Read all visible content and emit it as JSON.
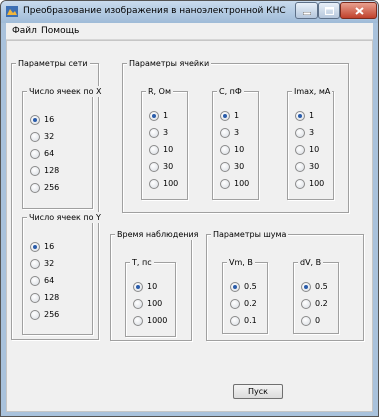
{
  "window": {
    "title": "Преобразование изображения в наноэлектронной КНС",
    "controls": {
      "minimize_icon": "minimize-icon",
      "maximize_icon": "maximize-icon",
      "close_icon": "close-icon"
    }
  },
  "menu": [
    {
      "label": "Файл"
    },
    {
      "label": "Помощь"
    }
  ],
  "network": {
    "title": "Параметры сети",
    "cells_x": {
      "title": "Число ячеек по X",
      "options": [
        "16",
        "32",
        "64",
        "128",
        "256"
      ],
      "selected": "16"
    },
    "cells_y": {
      "title": "Число ячеек по Y",
      "options": [
        "16",
        "32",
        "64",
        "128",
        "256"
      ],
      "selected": "16"
    }
  },
  "cell": {
    "title": "Параметры ячейки",
    "r": {
      "title": "R, Ом",
      "options": [
        "1",
        "3",
        "10",
        "30",
        "100"
      ],
      "selected": "1"
    },
    "c": {
      "title": "C, пФ",
      "options": [
        "1",
        "3",
        "10",
        "30",
        "100"
      ],
      "selected": "1"
    },
    "imax": {
      "title": "Imax, мА",
      "options": [
        "1",
        "3",
        "10",
        "30",
        "100"
      ],
      "selected": "1"
    }
  },
  "observation": {
    "title": "Время наблюдения",
    "t": {
      "title": "T, пс",
      "options": [
        "10",
        "100",
        "1000"
      ],
      "selected": "10"
    }
  },
  "noise": {
    "title": "Параметры шума",
    "vm": {
      "title": "Vm, В",
      "options": [
        "0.5",
        "0.2",
        "0.1"
      ],
      "selected": "0.5"
    },
    "dv": {
      "title": "dV, В",
      "options": [
        "0.5",
        "0.2",
        "0"
      ],
      "selected": "0.5"
    }
  },
  "start_button": {
    "label": "Пуск"
  }
}
